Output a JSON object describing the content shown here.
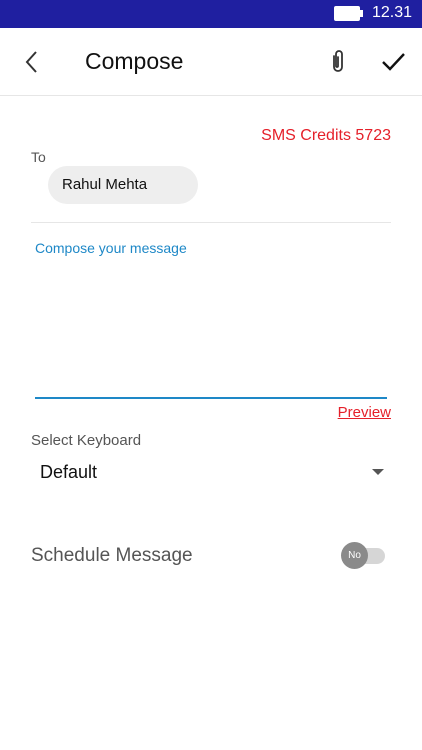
{
  "status_bar": {
    "time": "12.31",
    "battery_icon": "battery-icon"
  },
  "toolbar": {
    "title": "Compose",
    "back_icon": "back-chevron-icon",
    "attach_icon": "paperclip-icon",
    "send_icon": "checkmark-icon"
  },
  "sms_credits": "SMS Credits 5723",
  "to": {
    "label": "To",
    "recipient": "Rahul Mehta"
  },
  "message": {
    "placeholder": "Compose your message",
    "value": ""
  },
  "preview_label": "Preview",
  "keyboard": {
    "label": "Select Keyboard",
    "selected": "Default",
    "dropdown_icon": "dropdown-arrow-icon"
  },
  "schedule": {
    "label": "Schedule Message",
    "toggle_text": "No",
    "enabled": false
  },
  "colors": {
    "status_bar": "#1f1fa0",
    "accent_red": "#e5202a",
    "accent_blue": "#1e88c7"
  }
}
